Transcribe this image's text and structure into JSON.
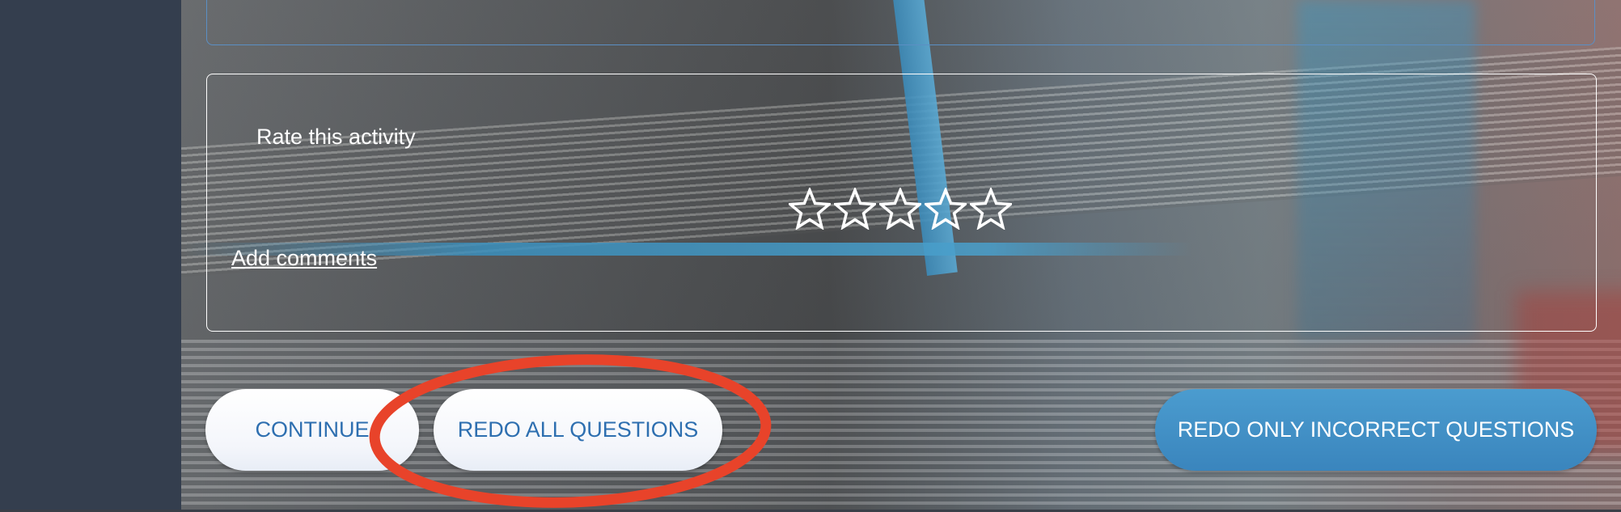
{
  "rating": {
    "label": "Rate this activity",
    "max_stars": 5,
    "selected_stars": 0,
    "star_icon": "star-outline-icon",
    "add_comments_label": "Add comments"
  },
  "actions": {
    "continue_label": "CONTINUE",
    "redo_all_label": "REDO ALL QUESTIONS",
    "redo_incorrect_label": "REDO ONLY INCORRECT QUESTIONS"
  },
  "colors": {
    "sidebar": "#343e4e",
    "primary_blue": "#3a85bd",
    "button_text_blue": "#2e6fb0",
    "annotation_red": "#e8432a"
  }
}
